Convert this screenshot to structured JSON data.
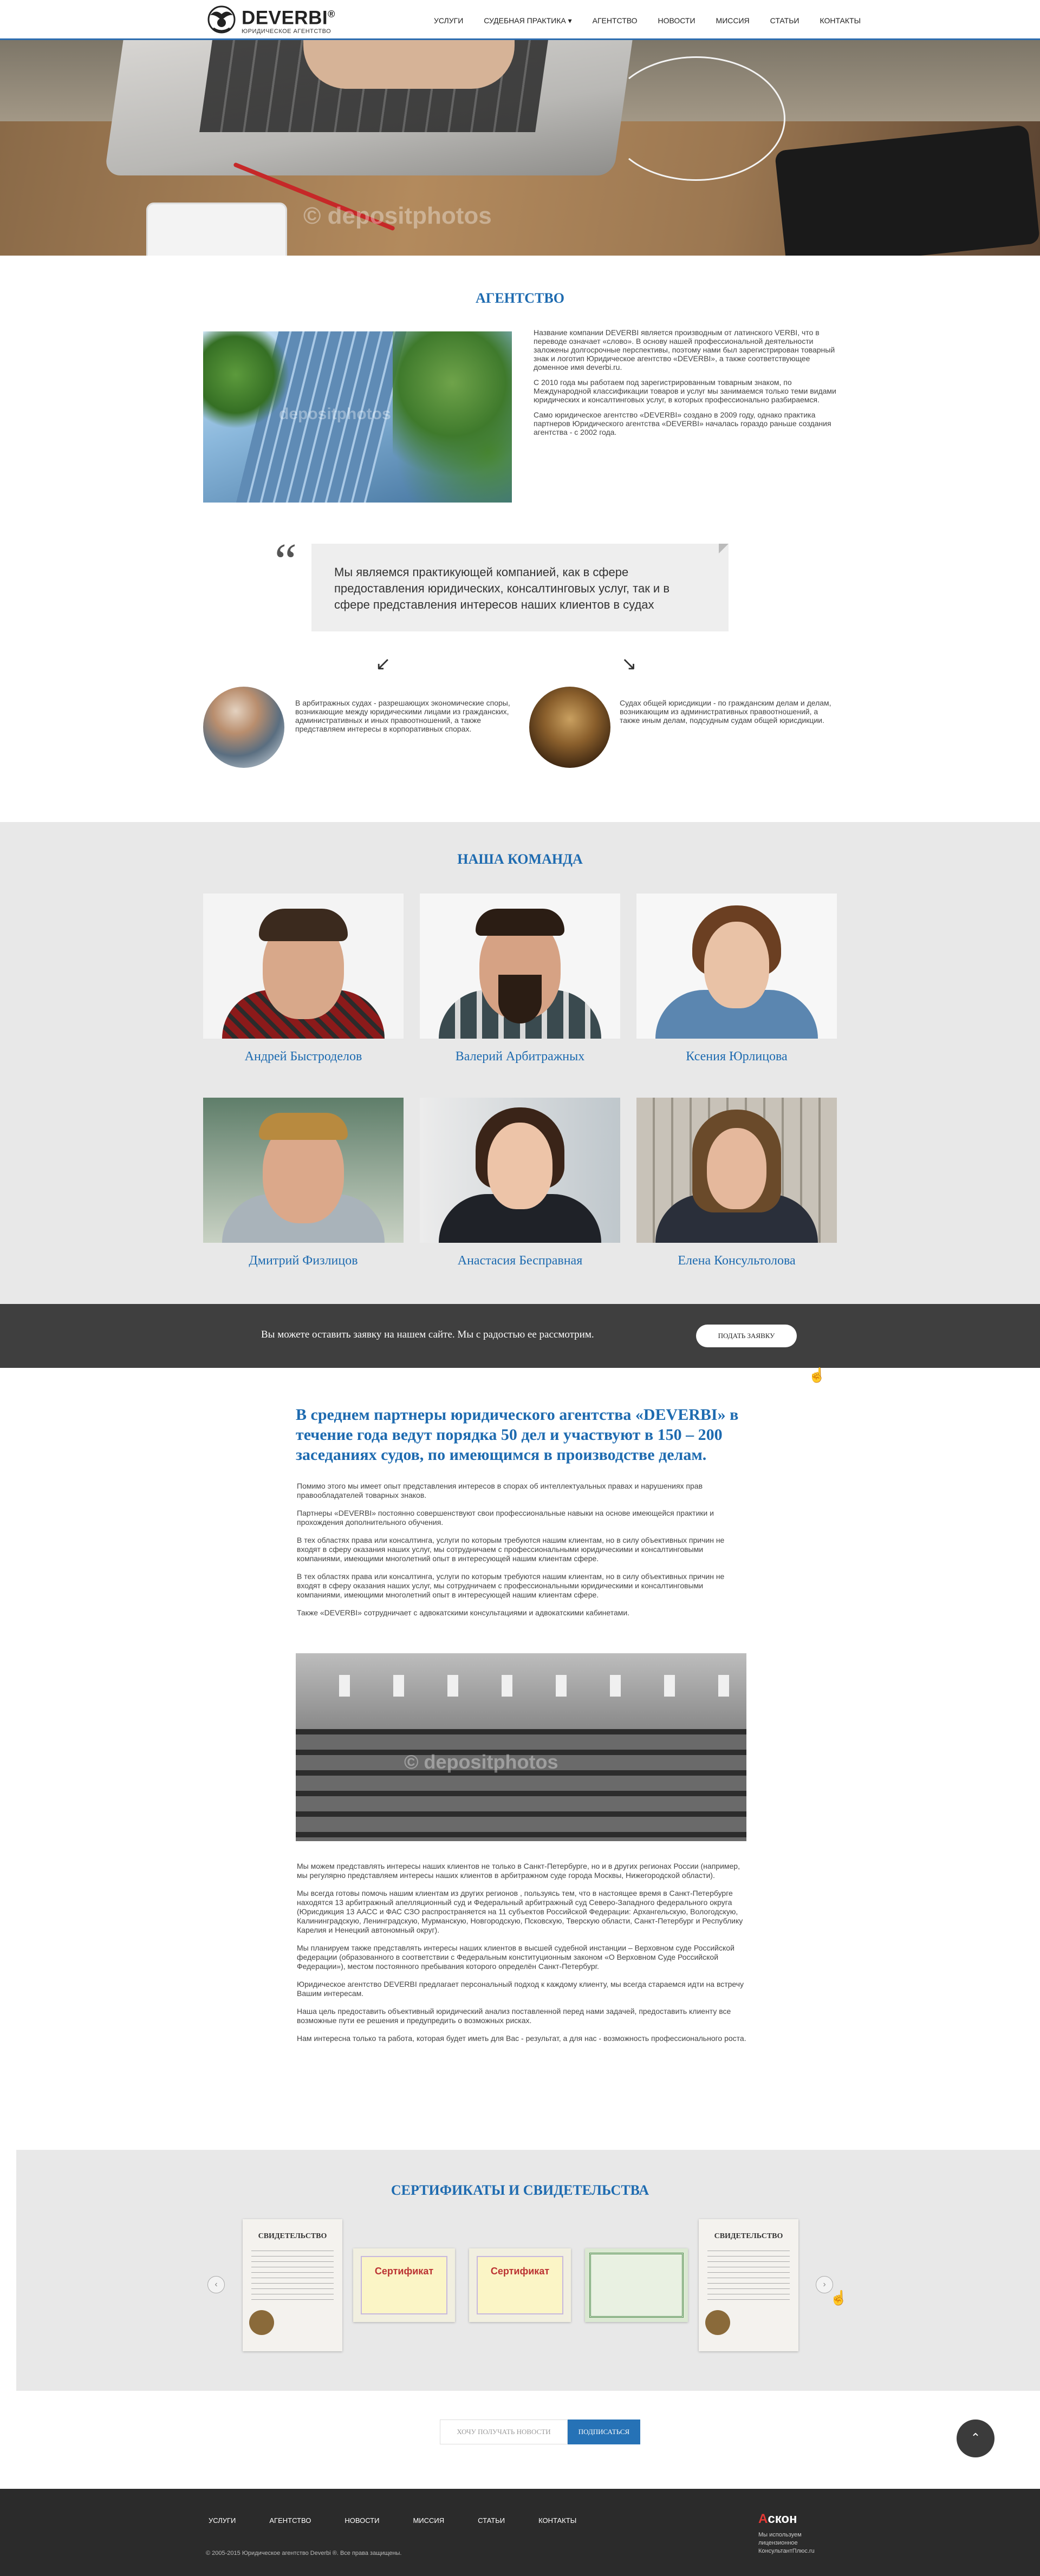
{
  "header": {
    "logo_name": "DEVERBI",
    "logo_reg": "®",
    "logo_sub": "ЮРИДИЧЕСКОЕ АГЕНТСТВО",
    "nav": [
      "Услуги",
      "Судебная практика ▾",
      "Агентство",
      "Новости",
      "Миссия",
      "Статьи",
      "Контакты"
    ]
  },
  "hero": {
    "watermark": "© depositphotos"
  },
  "agency": {
    "title": "Агентство",
    "image_watermark": "depositphotos",
    "paragraphs": [
      "Название компании DEVERBI является производным от латинского VERBI, что в переводе означает «слово». В основу нашей профессиональной деятельности заложены долгосрочные перспективы, поэтому нами был зарегистрирован товарный знак и логотип Юридическое агентство «DEVERBI», а также соответствующее доменное имя deverbi.ru.",
      "С 2010 года мы работаем под зарегистрированным товарным знаком, по Международной классификации товаров и услуг мы занимаемся только теми видами юридических и консалтинговых услуг, в которых профессионально разбираемся.",
      "Само юридическое агентство «DEVERBI» создано в 2009 году, однако практика партнеров Юридического агентства «DEVERBI» началась гораздо раньше создания агентства - с 2002 года."
    ],
    "quote": "Мы являемся практикующей компанией, как в сфере предоставления юридических, консалтинговых услуг, так и в сфере представления интересов наших клиентов в судах",
    "arrow_left": "↙",
    "arrow_right": "↘",
    "court_left": "В арбитражных судах - разрешающих экономические споры, возникающие между юридическими лицами из гражданских, административных и иных правоотношений, а также представляем интересы в корпоративных спорах.",
    "court_right": "Судах общей юрисдикции - по гражданским делам и делам, возникающим из административных правоотношений, а также иным делам, подсудным судам общей юрисдикции."
  },
  "team": {
    "title": "Наша команда",
    "members": [
      {
        "name": "Андрей Быстроделов"
      },
      {
        "name": "Валерий Арбитражных"
      },
      {
        "name": "Ксения Юрлицова"
      },
      {
        "name": "Дмитрий Физлицов"
      },
      {
        "name": "Анастасия Бесправная"
      },
      {
        "name": "Елена Консультолова"
      }
    ]
  },
  "request": {
    "text": "Вы можете оставить заявку на нашем сайте. Мы с радостью ее рассмотрим.",
    "button": "Подать заявку"
  },
  "article": {
    "heading": "В среднем партнеры юридического агентства «DEVERBI» в течение года ведут порядка 50 дел и участвуют в 150 – 200 заседаниях судов, по имеющимся в производстве делам.",
    "paragraphs_top": [
      "Помимо этого мы имеет опыт представления интересов в спорах об интеллектуальных правах и нарушениях прав правообладателей товарных знаков.",
      "Партнеры «DEVERBI» постоянно совершенствуют свои профессиональные навыки на основе имеющейся практики и прохождения дополнительного обучения.",
      "В тех областях права или консалтинга, услуги по которым требуются нашим клиентам, но в силу объективных причин не входят в сферу оказания наших услуг, мы сотрудничаем с профессиональными юридическими и консалтинговыми компаниями, имеющими многолетний опыт в интересующей нашим клиентам сфере.",
      "В тех областях права или консалтинга, услуги по которым требуются нашим клиентам, но в силу объективных причин не входят в сферу оказания наших услуг, мы сотрудничаем с профессиональными юридическими и консалтинговыми компаниями, имеющими многолетний опыт в интересующей нашим клиентам сфере.",
      "Также «DEVERBI» сотрудничает с адвокатскими консультациями и адвокатскими кабинетами."
    ],
    "image_watermark": "© depositphotos",
    "paragraphs_bottom": [
      "Мы можем представлять интересы наших клиентов не только в Санкт-Петербурге, но и в других регионах России (например, мы регулярно представляем интересы наших клиентов в арбитражном суде города Москвы, Нижегородской области).",
      "Мы всегда готовы помочь нашим клиентам из других регионов , пользуясь тем, что в настоящее время в Санкт-Петербурге находятся 13 арбитражный апелляционный суд и Федеральный арбитражный суд Северо-Западного федерального округа (Юрисдикция 13 ААСС и ФАС СЗО распространяется на 11 субъектов Российской Федерации: Архангельскую, Вологодскую, Калининградскую, Ленинградскую, Мурманскую, Новгородскую, Псковскую, Тверскую области, Санкт-Петербург и Республику Карелия и Ненецкий автономный округ).",
      "Мы планируем также представлять интересы наших клиентов в высшей судебной инстанции – Верховном суде Российской федерации (образованного в соответствии с Федеральным конституционным законом «О Верховном Суде Российской Федерации»), местом постоянного пребывания которого определён Санкт-Петербург.",
      "Юридическое агентство DEVERBI предлагает персональный подход к каждому клиенту, мы всегда стараемся идти на встречу Вашим интересам.",
      "Наша цель предоставить объективный юридический анализ поставленной перед нами задачей, предоставить клиенту все возможные пути ее решения и предупредить о возможных рисках.",
      "Нам интересна только та работа, которая будет иметь для Вас - результат, а для нас - возможность профессионального роста."
    ]
  },
  "certificates": {
    "title": "Сертификаты и свидетельства",
    "items": [
      {
        "label": "СВИДЕТЕЛЬСТВО",
        "kind": "svid"
      },
      {
        "label": "Сертификат",
        "kind": "sert"
      },
      {
        "label": "Сертификат",
        "kind": "sert"
      },
      {
        "label": "",
        "kind": "green"
      },
      {
        "label": "СВИДЕТЕЛЬСТВО",
        "kind": "svid"
      }
    ],
    "prev": "‹",
    "next": "›"
  },
  "subscribe": {
    "placeholder": "Хочу получать новости",
    "button": "Подписаться",
    "to_top": "⌃"
  },
  "footer": {
    "nav": [
      "Услуги",
      "Агентство",
      "Новости",
      "Миссия",
      "Статьи",
      "Контакты"
    ],
    "copyright": "© 2005-2015 Юридическое агентство Deverbi ®. Все права защищены.",
    "askon_mark": "А",
    "askon_name": "скон",
    "askon_sub": "Мы используем лицензионное КонсультантПлюс.ru"
  }
}
